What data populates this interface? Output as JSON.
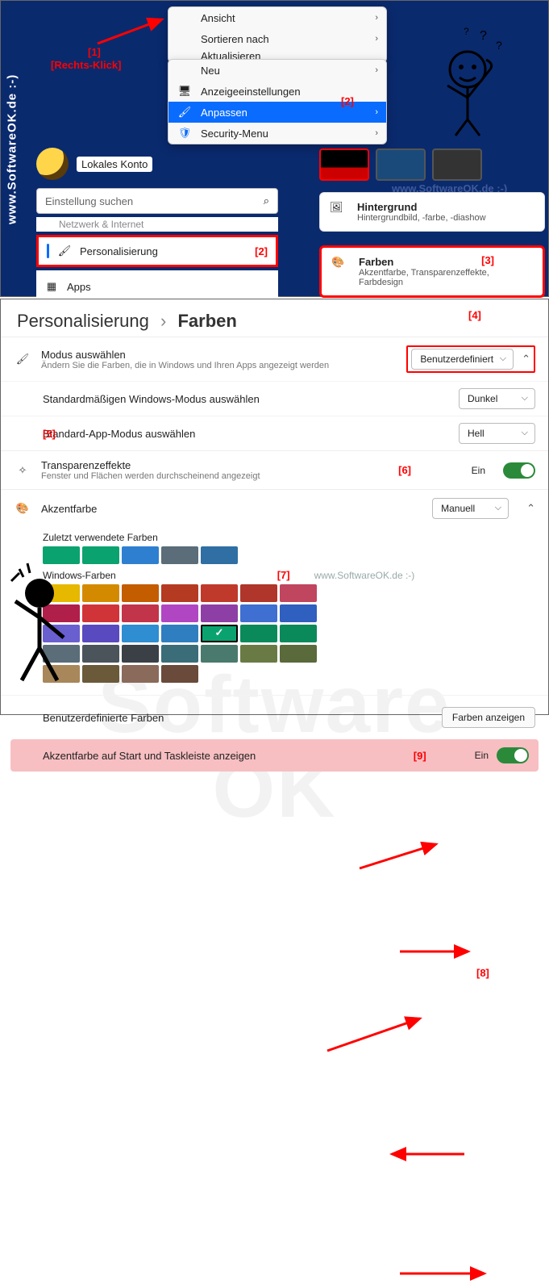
{
  "brand": "www.SoftwareOK.de :-)",
  "watermark": "www.SoftwareOK.de :-)",
  "context_menu_a": {
    "items": [
      {
        "label": "Ansicht",
        "submenu": true
      },
      {
        "label": "Sortieren nach",
        "submenu": true
      },
      {
        "label": "Aktualisieren",
        "submenu": false
      }
    ]
  },
  "context_menu_b": {
    "items": [
      {
        "label": "Neu",
        "submenu": true,
        "icon": ""
      },
      {
        "label": "Anzeigeeinstellungen",
        "submenu": false,
        "icon": "🖥"
      },
      {
        "label": "Anpassen",
        "submenu": true,
        "icon": "🖌",
        "highlight": true
      },
      {
        "label": "Security-Menu",
        "submenu": true,
        "icon": "🛡"
      }
    ]
  },
  "annotations": {
    "a1": "[1]",
    "a1b": "[Rechts-Klick]",
    "a2a": "[2]",
    "a2b": "[2]",
    "a3": "[3]",
    "a4": "[4]",
    "a5": "[5]",
    "a6": "[6]",
    "a7": "[7]",
    "a8": "[8]",
    "a9": "[9]"
  },
  "account": {
    "label": "Lokales Konto"
  },
  "search": {
    "placeholder": "Einstellung suchen"
  },
  "sidebar": {
    "cut": "Netzwerk & Internet",
    "pers": "Personalisierung",
    "apps": "Apps"
  },
  "card_bg": {
    "title": "Hintergrund",
    "sub": "Hintergrundbild, -farbe, -diashow"
  },
  "card_col": {
    "title": "Farben",
    "sub": "Akzentfarbe, Transparenzeffekte, Farbdesign"
  },
  "breadcrumb": {
    "a": "Personalisierung",
    "b": "Farben"
  },
  "mode": {
    "title": "Modus auswählen",
    "sub": "Ändern Sie die Farben, die in Windows und Ihren Apps angezeigt werden",
    "value": "Benutzerdefiniert",
    "win_label": "Standardmäßigen Windows-Modus auswählen",
    "win_value": "Dunkel",
    "app_label": "Standard-App-Modus auswählen",
    "app_value": "Hell"
  },
  "transparency": {
    "title": "Transparenzeffekte",
    "sub": "Fenster und Flächen werden durchscheinend angezeigt",
    "state": "Ein"
  },
  "accent": {
    "title": "Akzentfarbe",
    "mode": "Manuell",
    "recent_label": "Zuletzt verwendete Farben",
    "recent": [
      "#0aa36f",
      "#0aa36f",
      "#2f7fd1",
      "#5a6d78",
      "#2f6fa3"
    ],
    "win_label": "Windows-Farben",
    "palette": [
      "#e6b800",
      "#d48a00",
      "#c45c00",
      "#b53a22",
      "#c03a2b",
      "#b0352a",
      "#c0455f",
      "#b01e4a",
      "#d13438",
      "#c2344a",
      "#b146c2",
      "#8e3fa6",
      "#3f6fd1",
      "#2f5fbf",
      "#6a5fcf",
      "#5a4abf",
      "#2f8dd1",
      "#2f7fc0",
      "#0aa36f",
      "#0a8a5a",
      "#0a8a5a",
      "#5a6d78",
      "#4a545a",
      "#3a4045",
      "#3a6d78",
      "#4a7a6d",
      "#6a7a45",
      "#5a6a3a",
      "#a8875a",
      "#6a5a3a",
      "#8a6a5a",
      "#6a4a3a"
    ],
    "selected_index": 18,
    "custom_label": "Benutzerdefinierte Farben",
    "custom_btn": "Farben anzeigen",
    "taskbar_label": "Akzentfarbe auf Start und Taskleiste anzeigen",
    "taskbar_state": "Ein"
  }
}
